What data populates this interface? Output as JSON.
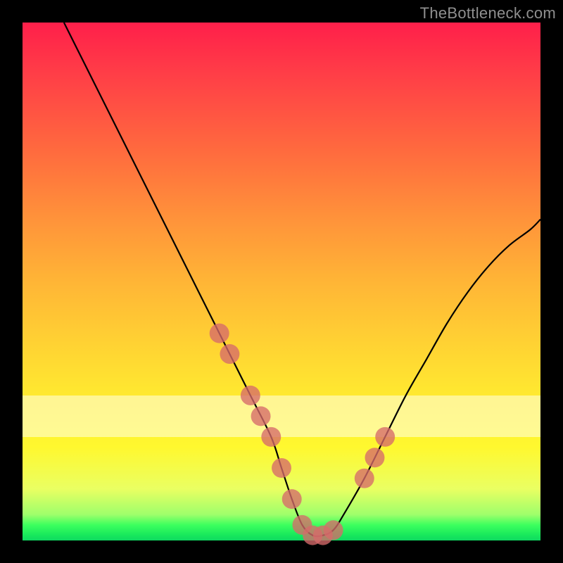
{
  "watermark": "TheBottleneck.com",
  "colors": {
    "background": "#000000",
    "gradient_top": "#ff1f4a",
    "gradient_bottom": "#0fd860",
    "curve_stroke": "#000000",
    "marker_fill": "#d66a6a",
    "band_fill": "rgba(255,255,230,0.55)",
    "watermark_text": "#8f8f8f"
  },
  "chart_data": {
    "type": "line",
    "title": "",
    "xlabel": "",
    "ylabel": "",
    "xlim": [
      0,
      100
    ],
    "ylim": [
      0,
      100
    ],
    "grid": false,
    "legend": false,
    "description": "V-shaped bottleneck curve on a red-to-green vertical gradient. Curve minimum sits near the green baseline around x≈55. Pink markers cluster along the curve near and around the minimum.",
    "series": [
      {
        "name": "curve",
        "x": [
          8,
          12,
          16,
          20,
          24,
          28,
          32,
          36,
          40,
          44,
          48,
          50,
          52,
          54,
          56,
          58,
          60,
          62,
          66,
          70,
          74,
          78,
          82,
          86,
          90,
          94,
          98,
          100
        ],
        "values": [
          100,
          92,
          84,
          76,
          68,
          60,
          52,
          44,
          36,
          28,
          20,
          14,
          8,
          3,
          1,
          1,
          2,
          5,
          12,
          20,
          28,
          35,
          42,
          48,
          53,
          57,
          60,
          62
        ]
      }
    ],
    "markers": {
      "name": "highlight-points",
      "x": [
        38,
        40,
        44,
        46,
        48,
        50,
        52,
        54,
        56,
        58,
        60,
        66,
        68,
        70
      ],
      "values": [
        40,
        36,
        28,
        24,
        20,
        14,
        8,
        3,
        1,
        1,
        2,
        12,
        16,
        20
      ],
      "r": 1.9
    },
    "bands": [
      {
        "y0": 20,
        "y1": 28
      }
    ]
  }
}
